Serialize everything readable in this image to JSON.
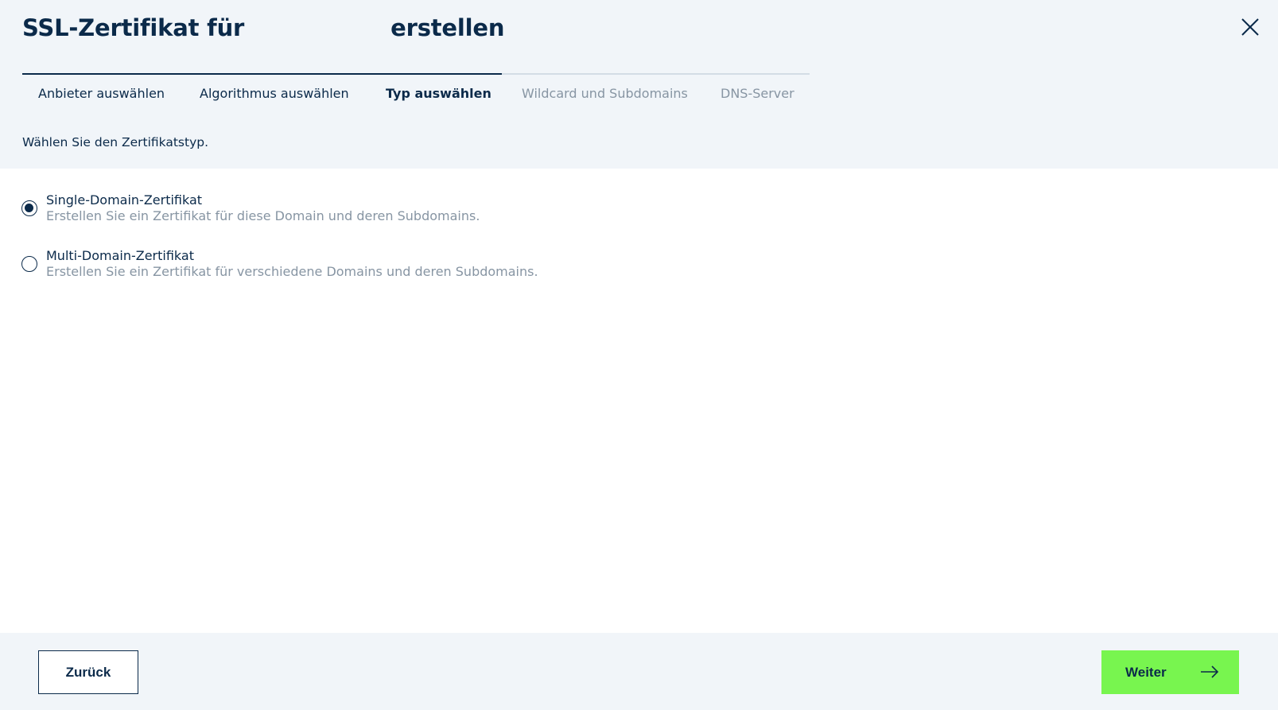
{
  "dialog": {
    "title_prefix": "SSL-Zertifikat für",
    "title_suffix": "erstellen"
  },
  "steps": [
    {
      "label": "Anbieter auswählen",
      "state": "done"
    },
    {
      "label": "Algorithmus auswählen",
      "state": "done"
    },
    {
      "label": "Typ auswählen",
      "state": "active"
    },
    {
      "label": "Wildcard und Subdomains",
      "state": "disabled"
    },
    {
      "label": "DNS-Server",
      "state": "disabled"
    }
  ],
  "instruction": "Wählen Sie den Zertifikatstyp.",
  "options": [
    {
      "label": "Single-Domain-Zertifikat",
      "description": "Erstellen Sie ein Zertifikat für diese Domain und deren Subdomains.",
      "selected": true
    },
    {
      "label": "Multi-Domain-Zertifikat",
      "description": "Erstellen Sie ein Zertifikat für verschiedene Domains und deren Subdomains.",
      "selected": false
    }
  ],
  "footer": {
    "back_label": "Zurück",
    "next_label": "Weiter"
  },
  "icons": {
    "close": "close-icon",
    "next": "arrow-right-icon"
  },
  "colors": {
    "primary": "#0b2a4a",
    "accent": "#78f54f",
    "muted": "#8795a3",
    "panel": "#f1f5f9"
  }
}
